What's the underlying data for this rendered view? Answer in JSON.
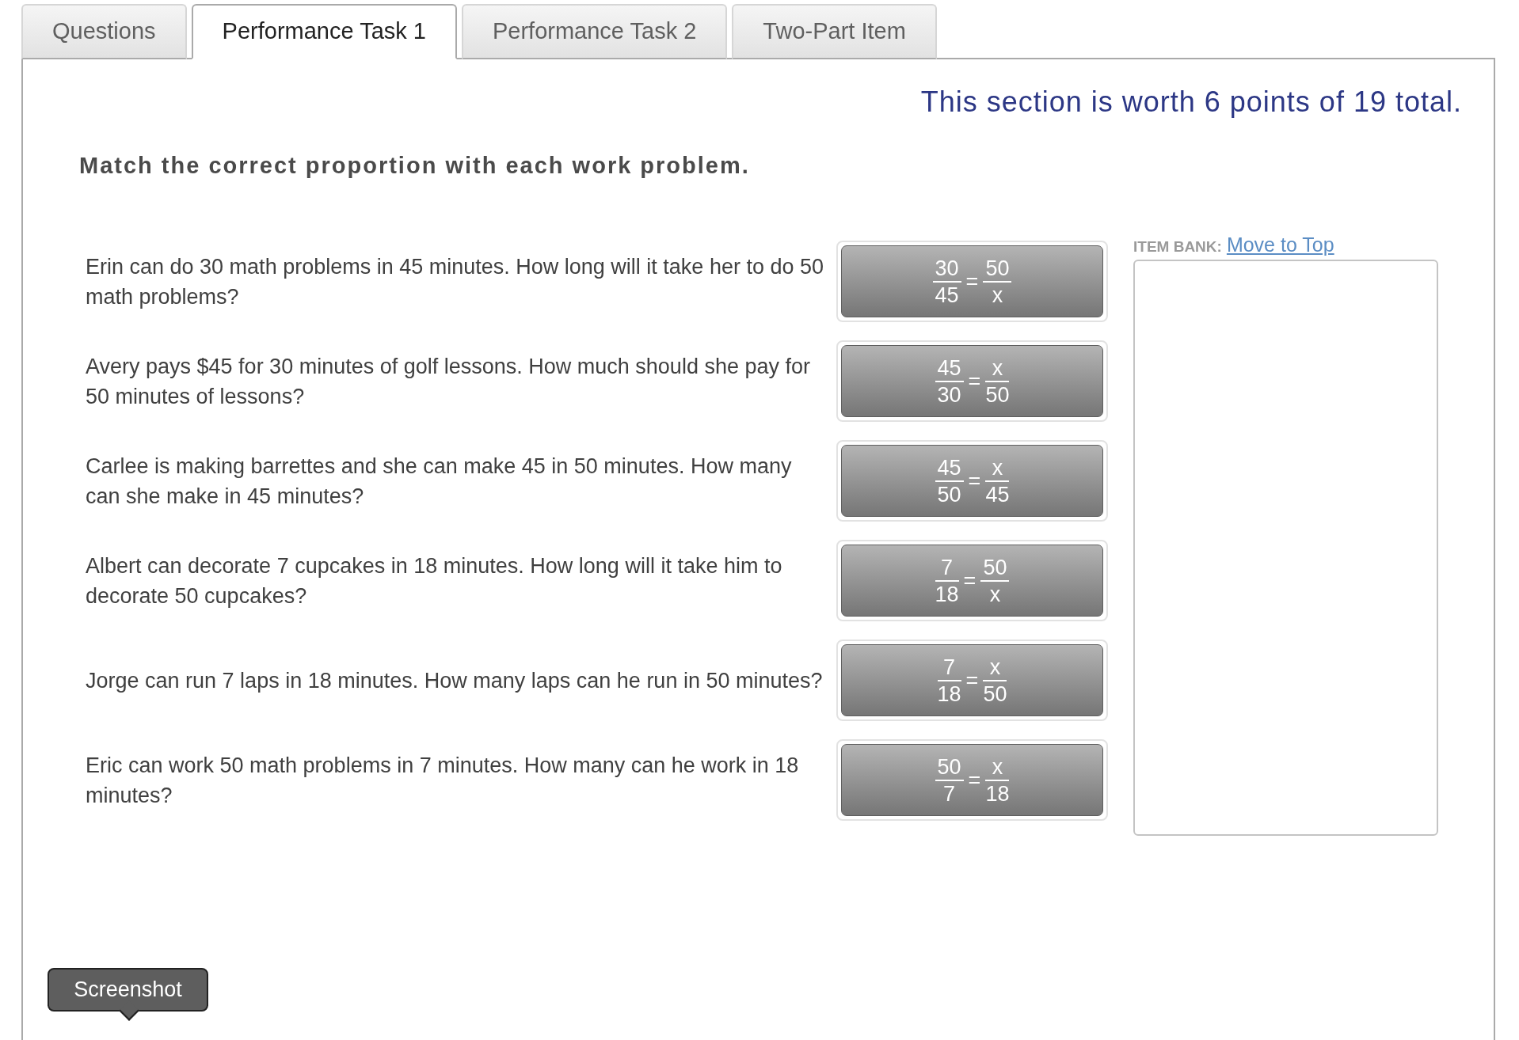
{
  "tabs": [
    {
      "label": "Questions",
      "selected": false
    },
    {
      "label": "Performance Task 1",
      "selected": true
    },
    {
      "label": "Performance Task 2",
      "selected": false
    },
    {
      "label": "Two-Part Item",
      "selected": false
    }
  ],
  "section_points": "This section is worth 6 points of 19 total.",
  "instruction": "Match the correct proportion with each work problem.",
  "problems": [
    {
      "text": "Erin can do 30 math problems in 45 minutes. How long will it take her to do 50 math problems?",
      "answer": {
        "left": {
          "numerator": "30",
          "denominator": "45"
        },
        "sign": "=",
        "right": {
          "numerator": "50",
          "denominator": "x"
        }
      }
    },
    {
      "text": "Avery pays $45 for 30 minutes of golf lessons. How much should she pay for 50 minutes of lessons?",
      "answer": {
        "left": {
          "numerator": "45",
          "denominator": "30"
        },
        "sign": "=",
        "right": {
          "numerator": "x",
          "denominator": "50"
        }
      }
    },
    {
      "text": "Carlee is making barrettes and she can make 45 in 50 minutes. How many can she make in 45 minutes?",
      "answer": {
        "left": {
          "numerator": "45",
          "denominator": "50"
        },
        "sign": "=",
        "right": {
          "numerator": "x",
          "denominator": "45"
        }
      }
    },
    {
      "text": "Albert can decorate 7 cupcakes in 18 minutes. How long will it take him to decorate 50 cupcakes?",
      "answer": {
        "left": {
          "numerator": "7",
          "denominator": "18"
        },
        "sign": "=",
        "right": {
          "numerator": "50",
          "denominator": "x"
        }
      }
    },
    {
      "text": "Jorge can run 7 laps in 18 minutes. How many laps can he run in 50 minutes?",
      "answer": {
        "left": {
          "numerator": "7",
          "denominator": "18"
        },
        "sign": "=",
        "right": {
          "numerator": "x",
          "denominator": "50"
        }
      }
    },
    {
      "text": "Eric can work 50 math problems in 7 minutes. How many can he work in 18 minutes?",
      "answer": {
        "left": {
          "numerator": "50",
          "denominator": "7"
        },
        "sign": "=",
        "right": {
          "numerator": "x",
          "denominator": "18"
        }
      }
    }
  ],
  "item_bank": {
    "label": "ITEM BANK:",
    "link": "Move to Top"
  },
  "tooltip": {
    "label": "Screenshot"
  }
}
